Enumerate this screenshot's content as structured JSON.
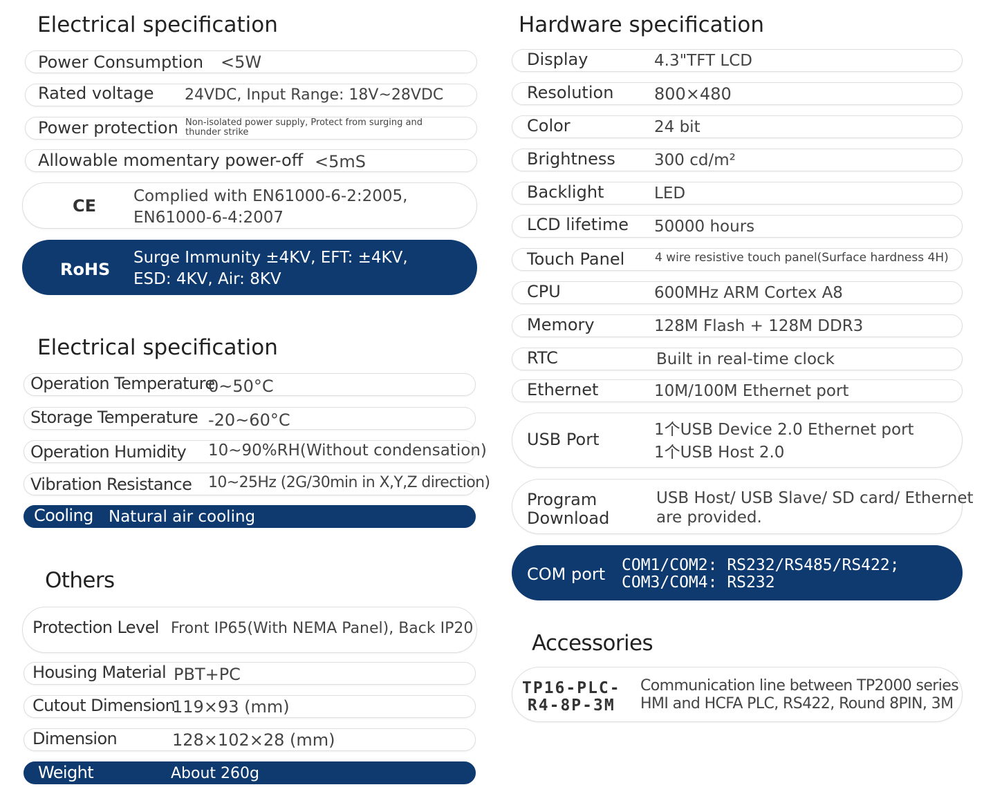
{
  "electrical": {
    "title": "Electrical specification",
    "rows": [
      {
        "label": "Power Consumption",
        "value": "<5W"
      },
      {
        "label": "Rated voltage",
        "value": "24VDC, Input Range: 18V~28VDC"
      },
      {
        "label": "Power protection",
        "value": "Non-isolated power supply,  Protect from surging and",
        "value2": "thunder strike"
      },
      {
        "label": "Allowable momentary power-off",
        "value": "<5mS"
      },
      {
        "label": "CE",
        "value": "Complied with EN61000-6-2:2005,",
        "value2": "EN61000-6-4:2007"
      },
      {
        "label": "RoHS",
        "value": "Surge Immunity  ±4KV, EFT: ±4KV,",
        "value2": "ESD: 4KV, Air: 8KV"
      }
    ]
  },
  "environment": {
    "title": "Electrical specification",
    "rows": [
      {
        "label": "Operation Temperature",
        "value": "0~50°C"
      },
      {
        "label": "Storage Temperature",
        "value": "-20~60°C"
      },
      {
        "label": "Operation Humidity",
        "value": "10~90%RH(Without condensation)"
      },
      {
        "label": "Vibration Resistance",
        "value": "10~25Hz (2G/30min in X,Y,Z direction)"
      },
      {
        "label": "Cooling",
        "value": "Natural air cooling"
      }
    ]
  },
  "others": {
    "title": "Others",
    "rows": [
      {
        "label": "Protection Level",
        "value": "Front IP65(With NEMA Panel), Back IP20"
      },
      {
        "label": "Housing Material",
        "value": "PBT+PC"
      },
      {
        "label": "Cutout Dimension",
        "value": "119×93 (mm)"
      },
      {
        "label": "Dimension",
        "value": "128×102×28 (mm)"
      },
      {
        "label": "Weight",
        "value": "About 260g"
      }
    ]
  },
  "hardware": {
    "title": "Hardware specification",
    "rows": [
      {
        "label": "Display",
        "value": "4.3\"TFT  LCD"
      },
      {
        "label": "Resolution",
        "value": "800×480"
      },
      {
        "label": "Color",
        "value": "24 bit"
      },
      {
        "label": "Brightness",
        "value": "300 cd/m²"
      },
      {
        "label": "Backlight",
        "value": "LED"
      },
      {
        "label": "LCD lifetime",
        "value": "50000 hours"
      },
      {
        "label": "Touch Panel",
        "value": "4 wire resistive touch panel(Surface hardness 4H)"
      },
      {
        "label": "CPU",
        "value": "600MHz ARM Cortex A8"
      },
      {
        "label": "Memory",
        "value": "128M Flash + 128M DDR3"
      },
      {
        "label": "RTC",
        "value": "Built in real-time clock"
      },
      {
        "label": "Ethernet",
        "value": "10M/100M Ethernet port"
      },
      {
        "label": "USB Port",
        "value": "1个USB Device 2.0 Ethernet port",
        "value2": "1个USB Host 2.0"
      },
      {
        "label": "Program",
        "label2": "Download",
        "value": "USB Host/ USB Slave/ SD card/ Ethernet",
        "value2": "are provided."
      },
      {
        "label": "COM port",
        "value": "COM1/COM2: RS232/RS485/RS422;",
        "value2": "COM3/COM4: RS232"
      }
    ]
  },
  "accessories": {
    "title": "Accessories",
    "rows": [
      {
        "label": "TP16-PLC-",
        "label2": "R4-8P-3M",
        "value": "Communication line between TP2000 series",
        "value2": "HMI and HCFA PLC, RS422, Round 8PIN, 3M"
      }
    ]
  },
  "colors": {
    "accent": "#0e3a70",
    "border": "#dedede",
    "text": "#333333"
  }
}
